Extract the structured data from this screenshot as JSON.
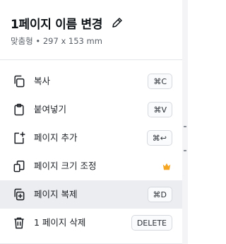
{
  "header": {
    "title": "1페이지 이름 변경",
    "subtitle": "맞춤형 • 297 x 153 mm",
    "edit_icon": "pencil-icon"
  },
  "menu": {
    "items": [
      {
        "label": "복사",
        "shortcut": "⌘C",
        "icon": "copy-icon"
      },
      {
        "label": "붙여넣기",
        "shortcut": "⌘V",
        "icon": "clipboard-icon"
      },
      {
        "label": "페이지 추가",
        "shortcut": "⌘↩",
        "icon": "add-page-icon"
      },
      {
        "label": "페이지 크기 조정",
        "shortcut": "",
        "icon": "resize-page-icon",
        "badge": "crown-icon",
        "badge_color": "#f5a623"
      },
      {
        "label": "페이지 복제",
        "shortcut": "⌘D",
        "icon": "duplicate-page-icon",
        "active": true
      },
      {
        "label": "1 페이지 삭제",
        "shortcut": "DELETE",
        "icon": "trash-icon"
      }
    ]
  },
  "colors": {
    "active_row": "#ecedf0",
    "text": "#1b1f24",
    "muted": "#5a6068"
  }
}
